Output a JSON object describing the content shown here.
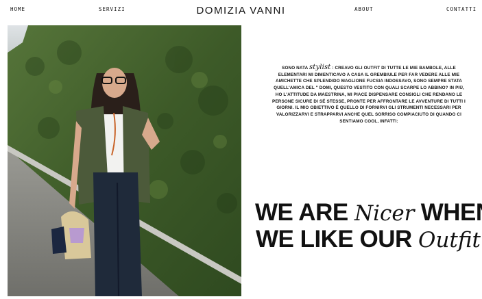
{
  "nav": {
    "home": "HOME",
    "services": "SERVIZI",
    "about": "ABOUT",
    "contacts": "CONTATTI",
    "logo": "DOMIZIA VANNI"
  },
  "bio": {
    "lead": "SONO NATA",
    "script_word": "stylist",
    "body": ": CREAVO GLI OUTFIT DI TUTTE LE MIE BAMBOLE, ALLE ELEMENTARI MI DIMENTICAVO A CASA IL GREMBIULE PER FAR VEDERE ALLE MIE AMICHETTE CHE SPLENDIDO MAGLIONE FUCSIA INDOSSAVO, SONO SEMPRE STATA QUELL'AMICA DEL \" DOMI, QUESTO VESTITO CON QUALI SCARPE LO ABBINO? IN PIÙ, HO L'ATTITUDE DA MAESTRINA, MI PIACE DISPENSARE CONSIGLI CHE RENDANO LE PERSONE SICURE DI SÉ STESSE, PRONTE PER AFFRONTARE LE AVVENTURE DI TUTTI I GIORNI. IL MIO OBIETTIVO È QUELLO DI FORNIRVI GLI STRUMENTI NECESSARI PER VALORIZZARVI E STRAPPARVI ANCHE QUEL SORRISO COMPIACIUTO DI QUANDO CI SENTIAMO COOL, INFATTI:"
  },
  "slogan": {
    "line1_a": "WE ARE",
    "line1_script": "Nicer",
    "line1_b": "WHEN",
    "line2_a": "WE LIKE OUR",
    "line2_script": "Outfit"
  },
  "colors": {
    "hedge": "#3f5a2a",
    "gravel": "#8a8a86",
    "vest": "#4c5a3a",
    "denim": "#1f2a3a"
  }
}
